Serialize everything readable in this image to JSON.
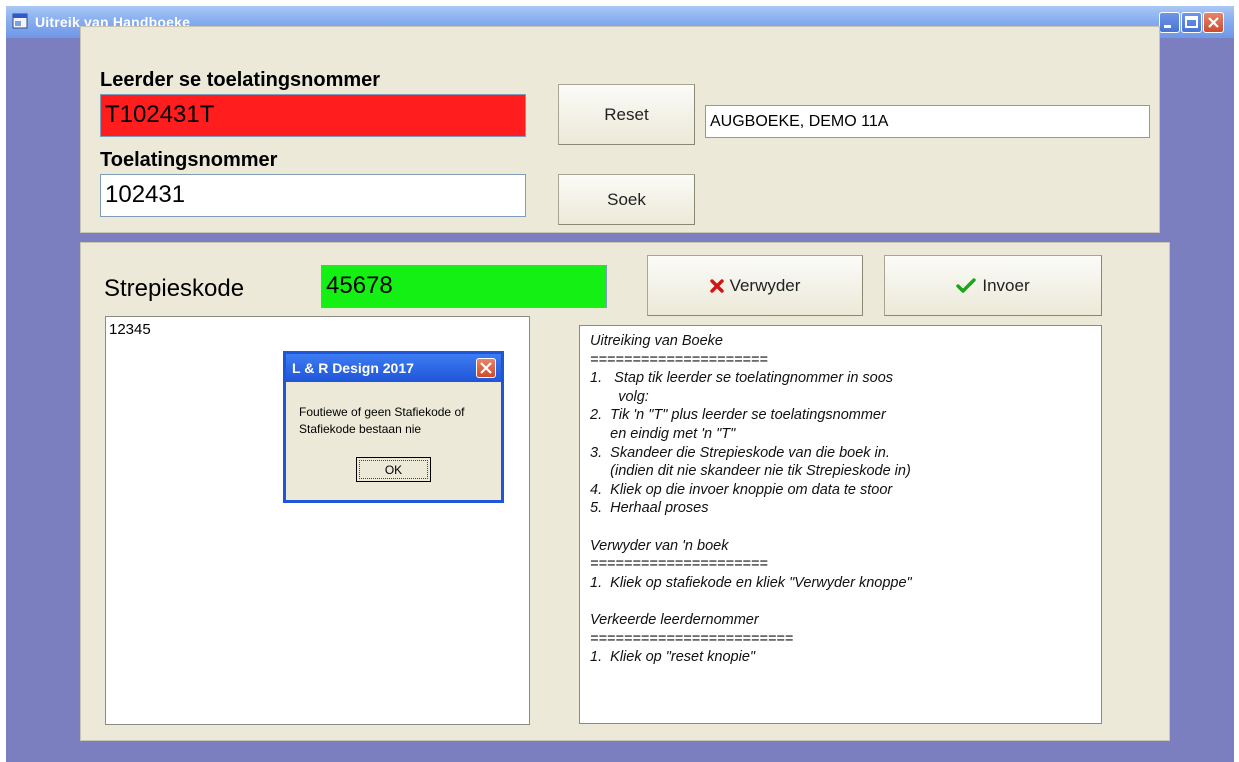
{
  "window": {
    "title": "Uitreik van Handboeke",
    "icon": "app-window-icon",
    "controls": [
      "minimize-icon",
      "maximize-icon",
      "close-icon"
    ]
  },
  "learner_panel": {
    "admission_label": "Leerder se toelatingsnommer",
    "admission_value": "T102431T",
    "admission_bg": "#ff1d1d",
    "number_label": "Toelatingsnommer",
    "number_value": "102431",
    "reset_label": "Reset",
    "search_label": "Soek",
    "student_name": "AUGBOEKE, DEMO 11A"
  },
  "barcode_panel": {
    "barcode_label": "Strepieskode",
    "barcode_value": "45678",
    "barcode_bg": "#14f014",
    "delete_label": "Verwyder",
    "delete_icon": "red-x-icon",
    "enter_label": "Invoer",
    "enter_icon": "green-check-icon",
    "list_items": [
      "12345"
    ],
    "help_text": "Uitreiking van Boeke\n=====================\n1.   Stap tik leerder se toelatingnommer in soos\n       volg:\n2.  Tik 'n \"T\" plus leerder se toelatingsnommer\n     en eindig met 'n \"T\"\n3.  Skandeer die Strepieskode van die boek in.\n     (indien dit nie skandeer nie tik Strepieskode in)\n4.  Kliek op die invoer knoppie om data te stoor\n5.  Herhaal proses\n\nVerwyder van 'n boek\n=====================\n1.  Kliek op stafiekode en kliek \"Verwyder knoppe\"\n\nVerkeerde leerdernommer\n========================\n1.  Kliek op \"reset knopie\""
  },
  "dialog": {
    "title": "L & R Design  2017",
    "message": "Foutiewe of geen Stafiekode of Stafiekode bestaan nie",
    "ok_label": "OK"
  }
}
